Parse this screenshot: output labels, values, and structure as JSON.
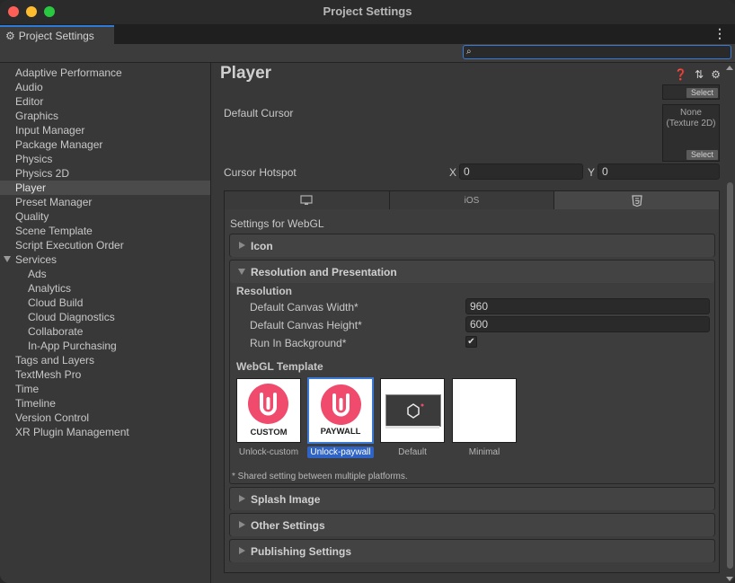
{
  "window": {
    "title": "Project Settings"
  },
  "tab": {
    "label": "Project Settings"
  },
  "search": {
    "placeholder": "",
    "value": ""
  },
  "sidebar": {
    "items": [
      "Adaptive Performance",
      "Audio",
      "Editor",
      "Graphics",
      "Input Manager",
      "Package Manager",
      "Physics",
      "Physics 2D",
      "Player",
      "Preset Manager",
      "Quality",
      "Scene Template",
      "Script Execution Order",
      "Services",
      "Ads",
      "Analytics",
      "Cloud Build",
      "Cloud Diagnostics",
      "Collaborate",
      "In-App Purchasing",
      "Tags and Layers",
      "TextMesh Pro",
      "Time",
      "Timeline",
      "Version Control",
      "XR Plugin Management"
    ],
    "selected": "Player"
  },
  "main": {
    "title": "Player",
    "select_label": "Select",
    "default_cursor_label": "Default Cursor",
    "cursor_none": "None",
    "cursor_type": "(Texture 2D)",
    "cursor_hotspot_label": "Cursor Hotspot",
    "hotspot_x_label": "X",
    "hotspot_x": "0",
    "hotspot_y_label": "Y",
    "hotspot_y": "0",
    "platform_tabs": [
      "",
      "iOS",
      ""
    ],
    "settings_for": "Settings for WebGL",
    "sections": {
      "icon": "Icon",
      "resolution": "Resolution and Presentation",
      "splash": "Splash Image",
      "other": "Other Settings",
      "publishing": "Publishing Settings"
    },
    "resolution": {
      "heading": "Resolution",
      "width_label": "Default Canvas Width*",
      "width_value": "960",
      "height_label": "Default Canvas Height*",
      "height_value": "600",
      "run_bg_label": "Run In Background*",
      "run_bg_checked": true
    },
    "webgl_template": {
      "heading": "WebGL Template",
      "templates": [
        {
          "caption": "CUSTOM",
          "label": "Unlock-custom",
          "selected": false
        },
        {
          "caption": "PAYWALL",
          "label": "Unlock-paywall",
          "selected": true
        },
        {
          "caption": "",
          "label": "Default",
          "selected": false
        },
        {
          "caption": "",
          "label": "Minimal",
          "selected": false
        }
      ]
    },
    "shared_note": "* Shared setting between multiple platforms."
  },
  "colors": {
    "accent": "#3a79d4",
    "brand_pink": "#f04a6c",
    "selection": "#2f64c4"
  }
}
